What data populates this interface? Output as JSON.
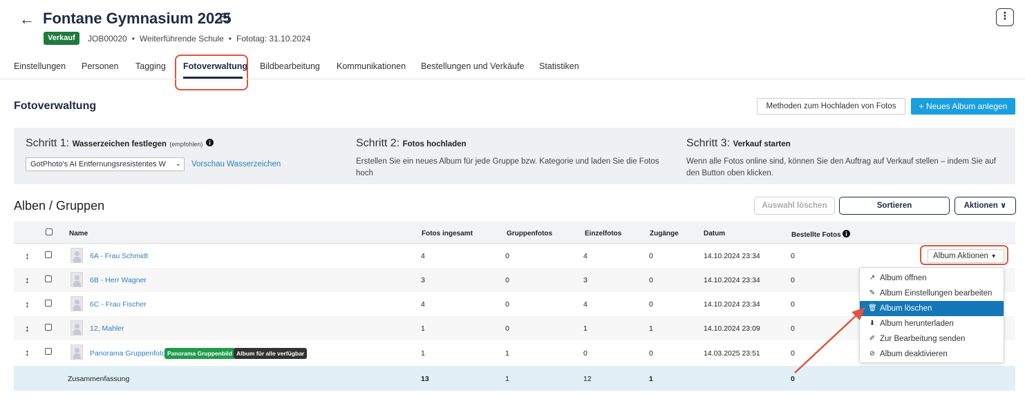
{
  "header": {
    "back_icon": "arrow-left-icon",
    "title": "Fontane Gymnasium 2025",
    "title_icon": "calendar-icon",
    "more_icon": "kebab-vertical-icon",
    "more_label": "⋮",
    "status_badge": "Verkauf",
    "job_id": "JOB00020",
    "school_type": "Weiterführende Schule",
    "photo_day": "Fototag: 31.10.2024",
    "separator": "•"
  },
  "tabs": [
    {
      "label": "Einstellungen"
    },
    {
      "label": "Personen"
    },
    {
      "label": "Tagging"
    },
    {
      "label": "Fotoverwaltung",
      "active": true
    },
    {
      "label": "Bildbearbeitung"
    },
    {
      "label": "Kommunikationen"
    },
    {
      "label": "Bestellungen und Verkäufe"
    },
    {
      "label": "Statistiken"
    }
  ],
  "section": {
    "title": "Fotoverwaltung",
    "upload_methods_label": "Methoden zum Hochladen von Fotos",
    "new_album_label": "+  Neues Album anlegen"
  },
  "steps": {
    "step1_prefix": "Schritt 1: ",
    "step1_title": "Wasserzeichen festlegen",
    "step1_hint": "(empfohlen)",
    "watermark_select_value": "GotPhoto's AI Entfernungsresistentes W",
    "watermark_preview_link": "Vorschau Wasserzeichen",
    "step2_prefix": "Schritt 2: ",
    "step2_title": "Fotos hochladen",
    "step2_text": "Erstellen Sie ein neues Album für jede Gruppe bzw. Kategorie und laden Sie die Fotos hoch",
    "step3_prefix": "Schritt 3: ",
    "step3_title": "Verkauf starten",
    "step3_text": "Wenn alle Fotos online sind, können Sie den Auftrag auf Verkauf stellen – indem Sie auf den Button oben klicken."
  },
  "albums": {
    "title": "Alben / Gruppen",
    "clear_selection_label": "Auswahl löschen",
    "sort_label": "Sortieren",
    "actions_label": "Aktionen ∨"
  },
  "table": {
    "columns": {
      "name": "Name",
      "total": "Fotos ingesamt",
      "group": "Gruppenfotos",
      "single": "Einzelfotos",
      "access": "Zugänge",
      "date": "Datum",
      "ordered": "Bestellte Fotos"
    },
    "rows": [
      {
        "name": "6A - Frau Schmidt",
        "total": "4",
        "group": "0",
        "single": "4",
        "access": "0",
        "date": "14.10.2024 23:34",
        "ordered": "0"
      },
      {
        "name": "6B - Herr Wagner",
        "total": "3",
        "group": "0",
        "single": "3",
        "access": "0",
        "date": "14.10.2024 23:34",
        "ordered": "0"
      },
      {
        "name": "6C - Frau Fischer",
        "total": "4",
        "group": "0",
        "single": "4",
        "access": "0",
        "date": "14.10.2024 23:34",
        "ordered": "0"
      },
      {
        "name": "12, Mahler",
        "total": "1",
        "group": "0",
        "single": "1",
        "access": "1",
        "date": "14.10.2024 23:09",
        "ordered": "0"
      },
      {
        "name": "Panorama Gruppenfoto",
        "tag1": "Panorama Gruppenbild",
        "tag2": "Album für alle verfügbar",
        "total": "1",
        "group": "1",
        "single": "0",
        "access": "0",
        "date": "14.03.2025 23:51",
        "ordered": "0"
      }
    ],
    "summary": {
      "label": "Zusammenfassung",
      "total": "13",
      "group": "1",
      "single": "12",
      "access": "1",
      "ordered": "0"
    },
    "drag_icon": "↕"
  },
  "album_actions": {
    "button_label": "Album Aktionen",
    "caret": "▾",
    "menu": [
      {
        "label": "Album öffnen",
        "icon": "↗"
      },
      {
        "label": "Album Einstellungen bearbeiten",
        "icon": "✎"
      },
      {
        "label": "Album löschen",
        "icon": "🗑",
        "active": true
      },
      {
        "label": "Album herunterladen",
        "icon": "⬇"
      },
      {
        "label": "Zur Bearbeitung senden",
        "icon": "✐"
      },
      {
        "label": "Album deaktivieren",
        "icon": "⊘"
      }
    ]
  },
  "colors": {
    "primary": "#1f2a44",
    "accent_blue": "#1a9fe0",
    "status_green": "#1f7a3e",
    "highlight_red": "#e0533e",
    "menu_active": "#1477b8"
  }
}
